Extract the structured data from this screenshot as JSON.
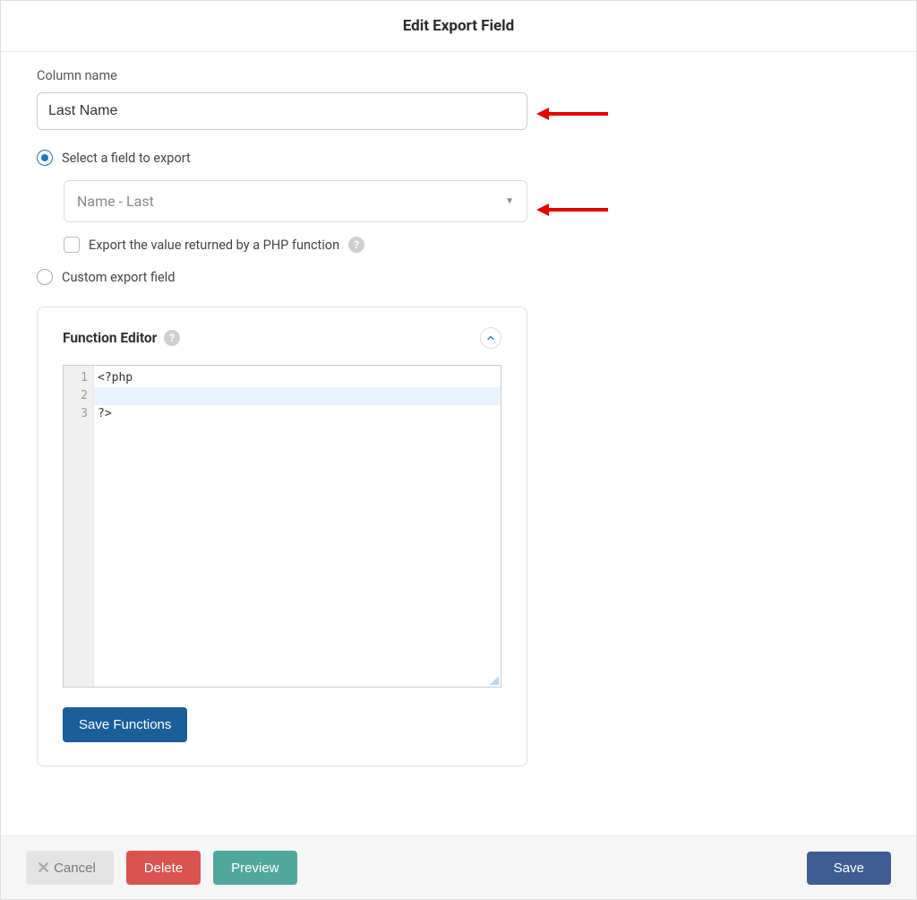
{
  "header": {
    "title": "Edit Export Field"
  },
  "columnName": {
    "label": "Column name",
    "value": "Last Name"
  },
  "exportMode": {
    "selectFieldLabel": "Select a field to export",
    "selectedFieldText": "Name - Last",
    "phpCheckboxLabel": "Export the value returned by a PHP function",
    "customLabel": "Custom export field"
  },
  "functionEditor": {
    "title": "Function Editor",
    "lines": {
      "l1": "<?php",
      "l2": "",
      "l3": "?>"
    },
    "saveBtn": "Save Functions"
  },
  "footer": {
    "cancel": "Cancel",
    "delete": "Delete",
    "preview": "Preview",
    "save": "Save"
  },
  "glyphs": {
    "help": "?",
    "caret": "▼",
    "x": "✕",
    "num1": "1",
    "num2": "2",
    "num3": "3"
  }
}
